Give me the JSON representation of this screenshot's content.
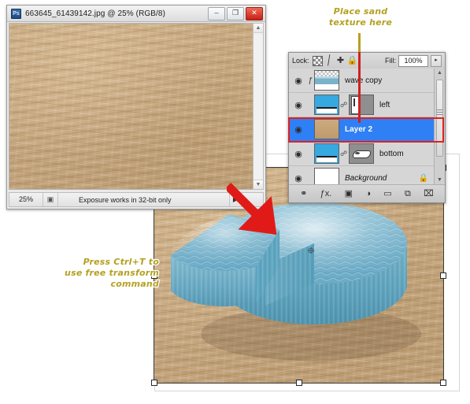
{
  "document_window": {
    "app_icon": "photoshop-icon",
    "title": "663645_61439142.jpg @ 25% (RGB/8)",
    "window_buttons": [
      {
        "name": "minimize-button",
        "glyph": "–"
      },
      {
        "name": "maximize-button",
        "glyph": "❐"
      },
      {
        "name": "close-button",
        "glyph": "✕"
      }
    ],
    "status_bar": {
      "zoom": "25%",
      "doc_icon": "document-icon",
      "message": "Exposure works in 32-bit only",
      "arrow": "▶",
      "tail": "◂"
    },
    "scrollbar": {
      "up": "▲",
      "down": "▼"
    }
  },
  "layers_panel": {
    "lock_row": {
      "label": "Lock:",
      "icons": [
        {
          "name": "lock-transparent-pixels-icon",
          "glyph": ""
        },
        {
          "name": "lock-image-pixels-icon",
          "glyph": "╱"
        },
        {
          "name": "lock-position-icon",
          "glyph": "✚"
        },
        {
          "name": "lock-all-icon",
          "glyph": "🔒"
        }
      ],
      "fill_label": "Fill:",
      "fill_value": "100%",
      "fill_arrow": "▸"
    },
    "layers": [
      {
        "name": "wave copy",
        "visible": true,
        "eye": "◉",
        "fx": "ƒ",
        "thumb": "wave-thumbnail",
        "has_link": false,
        "mask": null,
        "selected": false,
        "locked": false,
        "italic": false
      },
      {
        "name": "left",
        "visible": true,
        "eye": "◉",
        "fx": "",
        "thumb": "blue-gradient-thumbnail",
        "has_link": true,
        "link_glyph": "⛓",
        "mask": "left-mask-thumbnail",
        "selected": false,
        "locked": false,
        "italic": false
      },
      {
        "name": "Layer 2",
        "visible": true,
        "eye": "◉",
        "fx": "",
        "thumb": "sand-thumbnail",
        "has_link": false,
        "mask": null,
        "selected": true,
        "locked": false,
        "italic": false
      },
      {
        "name": "bottom",
        "visible": true,
        "eye": "◉",
        "fx": "",
        "thumb": "blue-gradient-thumbnail",
        "has_link": true,
        "link_glyph": "⛓",
        "mask": "bottom-mask-thumbnail",
        "selected": false,
        "locked": false,
        "italic": false
      },
      {
        "name": "Background",
        "visible": true,
        "eye": "◉",
        "fx": "",
        "thumb": "white-thumbnail",
        "has_link": false,
        "mask": null,
        "selected": false,
        "locked": true,
        "lock_glyph": "🔒",
        "italic": true
      }
    ],
    "scrollbar": {
      "up": "▲",
      "down": "▼"
    },
    "footer_buttons": [
      {
        "name": "link-layers-button",
        "glyph": "⚭"
      },
      {
        "name": "layer-style-fx-button",
        "glyph": "ƒx."
      },
      {
        "name": "add-layer-mask-button",
        "glyph": "▣"
      },
      {
        "name": "adjustment-layer-button",
        "glyph": "◑"
      },
      {
        "name": "new-group-button",
        "glyph": "▭"
      },
      {
        "name": "new-layer-button",
        "glyph": "⧉"
      },
      {
        "name": "delete-layer-button",
        "glyph": "⌧"
      }
    ]
  },
  "annotations": {
    "place_sand": "Place sand\ntexture here",
    "place_sand_lines": [
      "Place sand",
      "texture here"
    ],
    "free_transform_lines": [
      "Press Ctrl+T to",
      "use free transform",
      "command"
    ],
    "arrow": {
      "name": "red-arrow-icon",
      "color": "#e01b17",
      "direction": "down-right"
    },
    "highlight_color": "#e02020",
    "caption_color": "#b4a122"
  },
  "composition": {
    "background": "sand-texture",
    "pie_chart": {
      "name": "3d-water-pie-chart",
      "top_color": "#79b6cf",
      "side_color": "#5ba3c0",
      "slice_separated": true
    },
    "transform": {
      "active": true,
      "handles": 8,
      "center_reference": "✵"
    }
  }
}
